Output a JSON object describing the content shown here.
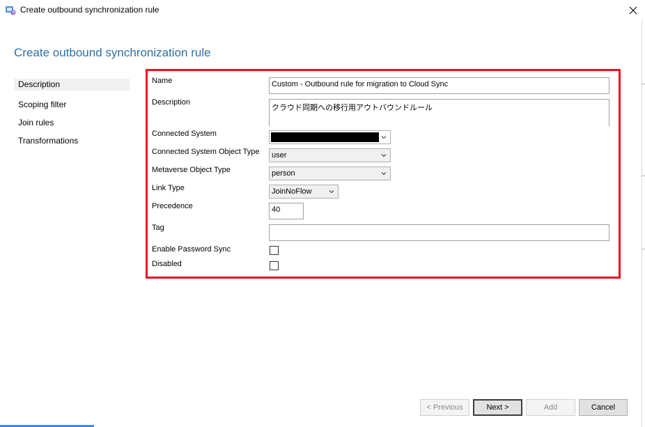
{
  "window": {
    "title": "Create outbound synchronization rule",
    "icon": "sync-service-icon",
    "close_glyph": "✕"
  },
  "heading": "Create outbound synchronization rule",
  "nav": {
    "items": [
      {
        "label": "Description",
        "selected": true
      },
      {
        "label": "Scoping filter",
        "selected": false
      },
      {
        "label": "Join rules",
        "selected": false
      },
      {
        "label": "Transformations",
        "selected": false
      }
    ]
  },
  "form": {
    "name_label": "Name",
    "name_value": "Custom - Outbound rule for migration to Cloud Sync",
    "description_label": "Description",
    "description_value": "クラウド同期への移行用アウトバウンドルール",
    "connected_system_label": "Connected System",
    "connected_system_value": "",
    "connected_system_object_type_label": "Connected System Object Type",
    "connected_system_object_type_value": "user",
    "metaverse_object_type_label": "Metaverse Object Type",
    "metaverse_object_type_value": "person",
    "link_type_label": "Link Type",
    "link_type_value": "JoinNoFlow",
    "precedence_label": "Precedence",
    "precedence_value": "40",
    "tag_label": "Tag",
    "tag_value": "",
    "enable_password_sync_label": "Enable Password Sync",
    "enable_password_sync_checked": false,
    "disabled_label": "Disabled",
    "disabled_checked": false
  },
  "buttons": {
    "previous": "< Previous",
    "next": "Next >",
    "add": "Add",
    "cancel": "Cancel"
  },
  "colors": {
    "heading": "#2e70a6",
    "highlight_border": "#e81123"
  }
}
